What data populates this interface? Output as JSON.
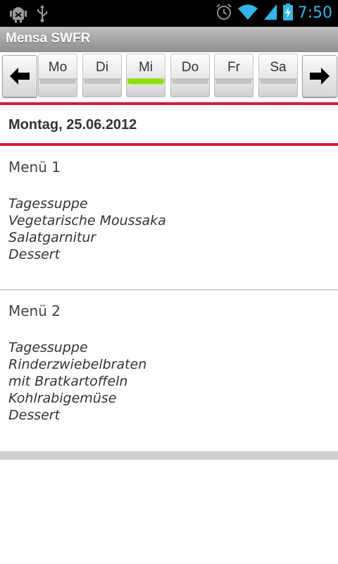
{
  "status_bar": {
    "time": "7:50",
    "icons": [
      "android-debug-icon",
      "usb-icon",
      "alarm-icon",
      "wifi-icon",
      "signal-icon",
      "battery-charging-icon"
    ],
    "time_color": "#33b5e5"
  },
  "app": {
    "title": "Mensa SWFR"
  },
  "day_nav": {
    "prev_icon": "arrow-left-icon",
    "next_icon": "arrow-right-icon",
    "days": [
      {
        "label": "Mo",
        "active": false
      },
      {
        "label": "Di",
        "active": false
      },
      {
        "label": "Mi",
        "active": true
      },
      {
        "label": "Do",
        "active": false
      },
      {
        "label": "Fr",
        "active": false
      },
      {
        "label": "Sa",
        "active": false
      }
    ],
    "active_color": "#8ee000"
  },
  "content": {
    "date_header": "Montag, 25.06.2012",
    "accent_color": "#d21f35",
    "menus": [
      {
        "title": "Menü 1",
        "items": [
          "Tagessuppe",
          "Vegetarische Moussaka",
          "Salatgarnitur",
          "Dessert"
        ]
      },
      {
        "title": "Menü 2",
        "items": [
          "Tagessuppe",
          "Rinderzwiebelbraten",
          "mit Bratkartoffeln",
          "Kohlrabigemüse",
          "Dessert"
        ]
      }
    ]
  }
}
